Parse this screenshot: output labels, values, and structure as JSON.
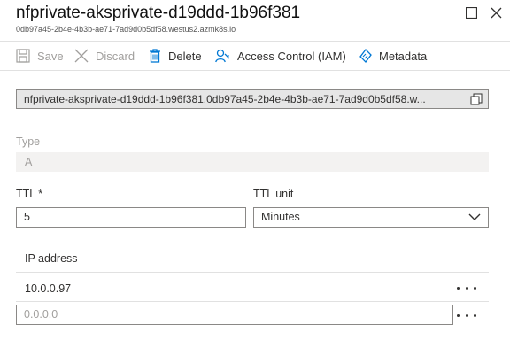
{
  "header": {
    "title": "nfprivate-aksprivate-d19ddd-1b96f381",
    "subtitle": "0db97a45-2b4e-4b3b-ae71-7ad9d0b5df58.westus2.azmk8s.io"
  },
  "toolbar": {
    "save_label": "Save",
    "discard_label": "Discard",
    "delete_label": "Delete",
    "iam_label": "Access Control (IAM)",
    "metadata_label": "Metadata"
  },
  "record": {
    "fqdn": "nfprivate-aksprivate-d19ddd-1b96f381.0db97a45-2b4e-4b3b-ae71-7ad9d0b5df58.w...",
    "type_label": "Type",
    "type_value": "A",
    "ttl_label": "TTL *",
    "ttl_value": "5",
    "ttl_unit_label": "TTL unit",
    "ttl_unit_value": "Minutes"
  },
  "ip_table": {
    "header": "IP address",
    "rows": [
      "10.0.0.97"
    ],
    "new_placeholder": "0.0.0.0"
  },
  "colors": {
    "accent": "#0078d4",
    "disabled": "#a19f9d"
  },
  "icons": [
    "maximize-icon",
    "close-icon",
    "save-icon",
    "discard-icon",
    "delete-icon",
    "iam-icon",
    "metadata-icon",
    "copy-icon",
    "chevron-down-icon",
    "more-icon"
  ]
}
